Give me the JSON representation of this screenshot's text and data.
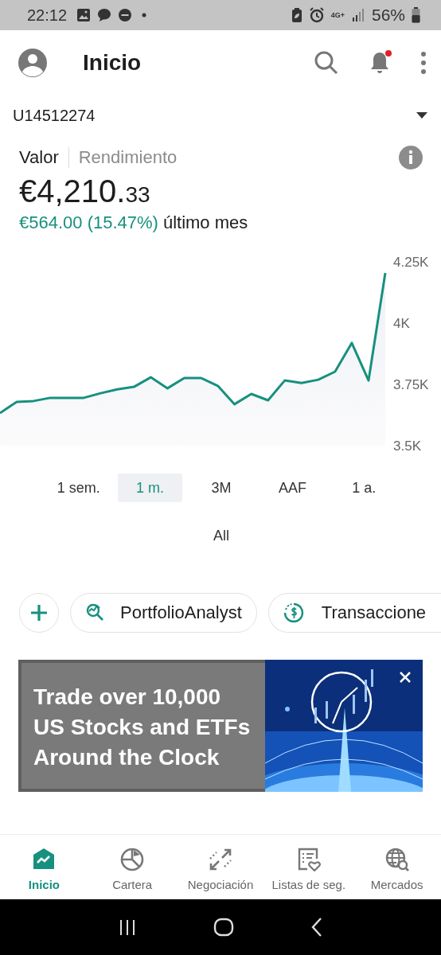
{
  "status_bar": {
    "time": "22:12",
    "network": "4G+",
    "battery": "56%"
  },
  "header": {
    "title": "Inicio",
    "notification_badge": true
  },
  "account": {
    "id": "U14512274"
  },
  "view_toggle": [
    {
      "label": "Valor",
      "selected": true
    },
    {
      "label": "Rendimiento",
      "selected": false
    }
  ],
  "balance": {
    "integer": "€4,210.",
    "decimals": "33"
  },
  "change": {
    "amount": "€564.00 (15.47%)",
    "period": "último mes"
  },
  "chart": {
    "chart_data": {
      "type": "area",
      "ylim": [
        3500,
        4250
      ],
      "yticks": [
        {
          "value": 3500,
          "label": "3.5K"
        },
        {
          "value": 3750,
          "label": "3.75K"
        },
        {
          "value": 4000,
          "label": "4K"
        },
        {
          "value": 4250,
          "label": "4.25K"
        }
      ],
      "series": [
        {
          "color": "#17907f",
          "values": [
            3633,
            3679,
            3682,
            3695,
            3695,
            3695,
            3714,
            3730,
            3740,
            3779,
            3734,
            3776,
            3776,
            3744,
            3669,
            3711,
            3685,
            3766,
            3756,
            3769,
            3802,
            3919,
            3766,
            4205
          ]
        }
      ]
    }
  },
  "ranges": [
    {
      "label": "1 sem.",
      "selected": false
    },
    {
      "label": "1 m.",
      "selected": true
    },
    {
      "label": "3M",
      "selected": false
    },
    {
      "label": "AAF",
      "selected": false
    },
    {
      "label": "1 a.",
      "selected": false
    },
    {
      "label": "All",
      "selected": false
    }
  ],
  "shortcuts": [
    {
      "kind": "add"
    },
    {
      "kind": "analyst",
      "label": "PortfolioAnalyst"
    },
    {
      "kind": "transactions",
      "label": "Transaccione"
    }
  ],
  "banner": {
    "lines": [
      "Trade over 10,000",
      "US Stocks and ETFs",
      "Around the Clock"
    ],
    "kind": "picture"
  },
  "bottom_nav": [
    {
      "label": "Inicio",
      "kind": "home",
      "selected": true
    },
    {
      "label": "Cartera",
      "kind": "portfolio",
      "selected": false
    },
    {
      "label": "Negociación",
      "kind": "trade",
      "selected": false
    },
    {
      "label": "Listas de seg.",
      "kind": "watchlist",
      "selected": false
    },
    {
      "label": "Mercados",
      "kind": "markets",
      "selected": false
    }
  ]
}
